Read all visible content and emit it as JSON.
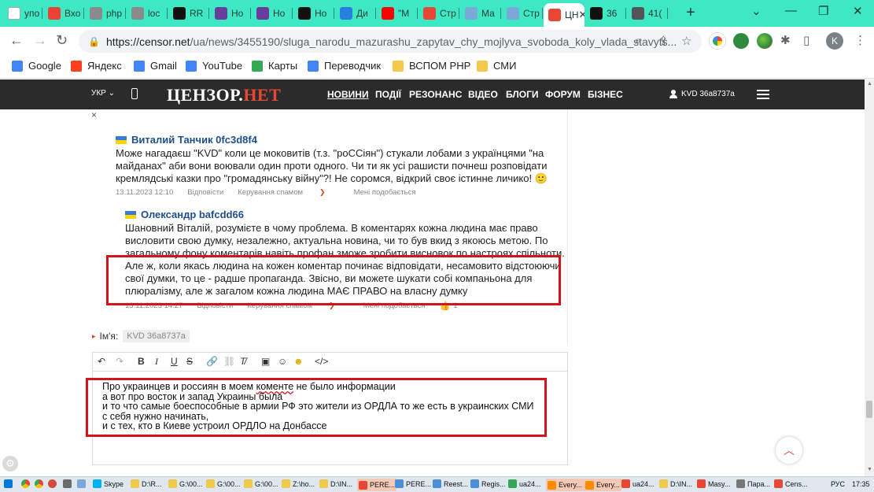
{
  "browser": {
    "tabs": [
      {
        "label": "упо",
        "icon": "google-icon",
        "color": "#ffffff"
      },
      {
        "label": "Вхо",
        "icon": "gmail-icon",
        "color": "#ea4335"
      },
      {
        "label": "php",
        "icon": "image-icon",
        "color": "#8a8a8a"
      },
      {
        "label": "loc",
        "icon": "image-icon",
        "color": "#8a8a8a"
      },
      {
        "label": "RR",
        "icon": "d-logo-icon",
        "color": "#111111"
      },
      {
        "label": "Но",
        "icon": "rbc-icon",
        "color": "#6a3d9a"
      },
      {
        "label": "Но",
        "icon": "rbc-icon",
        "color": "#6a3d9a"
      },
      {
        "label": "Но",
        "icon": "a-logo-icon",
        "color": "#111111"
      },
      {
        "label": "Ди",
        "icon": "d-logo-icon",
        "color": "#2a7de1"
      },
      {
        "label": "\"М",
        "icon": "youtube-icon",
        "color": "#ff0000"
      },
      {
        "label": "Стр",
        "icon": "censor-icon",
        "color": "#e94735"
      },
      {
        "label": "Ма",
        "icon": "page-icon",
        "color": "#7aa8d8"
      },
      {
        "label": "Стр",
        "icon": "page-icon",
        "color": "#7aa8d8"
      },
      {
        "label": "ЦН",
        "icon": "censor-icon",
        "color": "#e94735",
        "active": true
      },
      {
        "label": "36",
        "icon": "raz-icon",
        "color": "#111111"
      },
      {
        "label": "41(",
        "icon": "globe-icon",
        "color": "#555555"
      }
    ],
    "new_tab": "+",
    "url_host": "https://censor.net",
    "url_path": "/ua/news/3455190/sluga_narodu_mazurashu_zapytav_chy_mojlyva_svoboda_koly_vlada_stavyts...",
    "profile_initial": "K",
    "bookmarks": [
      {
        "label": "Google",
        "icon": "google-icon",
        "color": "#4285f4"
      },
      {
        "label": "Яндекс",
        "icon": "yandex-icon",
        "color": "#fc3f1d"
      },
      {
        "label": "Gmail",
        "icon": "google-icon",
        "color": "#4285f4"
      },
      {
        "label": "YouTube",
        "icon": "google-icon",
        "color": "#4285f4"
      },
      {
        "label": "Карты",
        "icon": "maps-icon",
        "color": "#34a853"
      },
      {
        "label": "Переводчик",
        "icon": "translate-icon",
        "color": "#4285f4"
      },
      {
        "label": "ВСПОМ PHP",
        "icon": "folder-icon",
        "color": "#f2c94c"
      },
      {
        "label": "СМИ",
        "icon": "folder-icon",
        "color": "#f2c94c"
      }
    ]
  },
  "site": {
    "lang": "УКР",
    "logo_main": "ЦЕНЗОР.",
    "logo_accent": "НЕТ",
    "nav": [
      "НОВИНИ",
      "ПОДІЇ",
      "РЕЗОНАНС",
      "ВІДЕО",
      "БЛОГИ",
      "ФОРУМ",
      "БІЗНЕС"
    ],
    "user": "KVD 36a8737a",
    "colors": {
      "accent": "#e94735",
      "header_bg": "#2b2b2b",
      "highlight": "#d4141d"
    }
  },
  "comments": [
    {
      "author": "Виталий Танчик 0fc3d8f4",
      "text": "Може нагадаєш \"KVD\" коли це моковитів (т.з. \"роССіян\") стукали лобами з українцями \"на майданах\" аби вони воювали один проти одного. Чи ти як усі рашисти почнеш розповідати кремлядські казки про \"громадянську війну\"?! Не соромся, відкрий своє істинне личико! 🙂",
      "date": "13.11.2023 12:10",
      "reply": "Відповісти",
      "spam": "Керування спамом",
      "like": "Мені подобається"
    },
    {
      "author": "Олександр bafcdd66",
      "text": "Шановний Віталій, розумієте в чому проблема. В коментарях кожна людина має право висловити свою думку, незалежно, актуальна новина, чи то був вкид з якоюсь метою. По загальному фону коментарів навіть профан зможе зробити висновок по настроях спільноти. Але ж, коли якась людина на кожен коментар починає відповідати, несамовито відстоюючи свої думки, то це - радше пропаганда. Звісно, ви можете шукати собі компаньона для плюралізму, але ж загалом кожна людина МАЄ ПРАВО на власну думку",
      "date": "13.11.2023 14:27",
      "reply": "Відповісти",
      "spam": "Керування спамом",
      "like": "Мені подобається",
      "likes": "1"
    }
  ],
  "form": {
    "name_label": "Ім'я:",
    "name_value": "KVD 36a8737a",
    "text_lines": [
      "Про украинцев и россиян в моем ",
      "коменте",
      " не было информации",
      "а вот про восток и запад Украины была",
      "и то что самые боеспособные в армии РФ это жители из ОРДЛА то же есть в украинских СМИ",
      "с себя нужно начинать,",
      "и с тех, кто в Киеве устроил ОРДЛО на Донбассе"
    ]
  },
  "taskbar": {
    "items": [
      {
        "label": "Skype",
        "color": "#00aff0"
      },
      {
        "label": "D:\\R...",
        "color": "#f2c94c"
      },
      {
        "label": "G:\\00...",
        "color": "#f2c94c"
      },
      {
        "label": "G:\\00...",
        "color": "#f2c94c"
      },
      {
        "label": "G:\\00...",
        "color": "#f2c94c"
      },
      {
        "label": "Z:\\ho...",
        "color": "#f2c94c"
      },
      {
        "label": "D:\\IN...",
        "color": "#f2c94c"
      },
      {
        "label": "PERE...",
        "color": "#e94735",
        "active": true
      },
      {
        "label": "PERE...",
        "color": "#4a90d9"
      },
      {
        "label": "Reest...",
        "color": "#4a90d9"
      },
      {
        "label": "Regis...",
        "color": "#4a90d9"
      },
      {
        "label": "ua24...",
        "color": "#34a853"
      },
      {
        "label": "Every...",
        "color": "#ff8c00",
        "active": true
      },
      {
        "label": "Every...",
        "color": "#ff8c00",
        "active": true
      },
      {
        "label": "ua24...",
        "color": "#e94735"
      },
      {
        "label": "D:\\IN...",
        "color": "#f2c94c"
      },
      {
        "label": "Masy...",
        "color": "#e94735"
      },
      {
        "label": "Пара...",
        "color": "#777777"
      },
      {
        "label": "Cens...",
        "color": "#e94735"
      }
    ],
    "lang": "РУС",
    "clock": "17:35"
  }
}
